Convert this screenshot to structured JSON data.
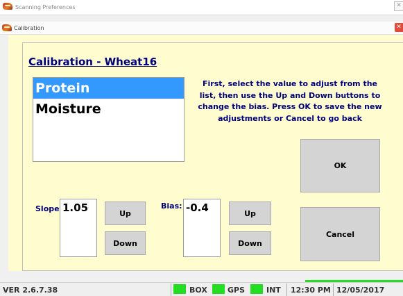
{
  "outer_window": {
    "title": "Scanning Preferences",
    "close_glyph": "✕"
  },
  "dialog": {
    "title": "Calibration",
    "close_glyph": "✕"
  },
  "calibration": {
    "heading": "Calibration - Wheat16",
    "list_items": [
      "Protein",
      "Moisture"
    ],
    "selected_item": "Protein",
    "instructions": "First, select the value to adjust from the list, then use the Up and Down buttons to change the bias. Press OK to save the new adjustments or Cancel to go back",
    "slope": {
      "label": "Slope:",
      "value": "1.05",
      "up_label": "Up",
      "down_label": "Down"
    },
    "bias": {
      "label": "Bias:",
      "value": "-0.4",
      "up_label": "Up",
      "down_label": "Down"
    },
    "ok_label": "OK",
    "cancel_label": "Cancel"
  },
  "status_bar": {
    "version": "VER 2.6.7.38",
    "indicators": [
      {
        "label": "BOX",
        "color": "#22dd22"
      },
      {
        "label": "GPS",
        "color": "#22dd22"
      },
      {
        "label": "INT",
        "color": "#22dd22"
      }
    ],
    "time": "12:30 PM",
    "date": "12/05/2017"
  },
  "colors": {
    "dialog_background": "#fffdd0",
    "label_text": "#00007a",
    "selection": "#3399ff",
    "indicator_green": "#22dd22"
  }
}
